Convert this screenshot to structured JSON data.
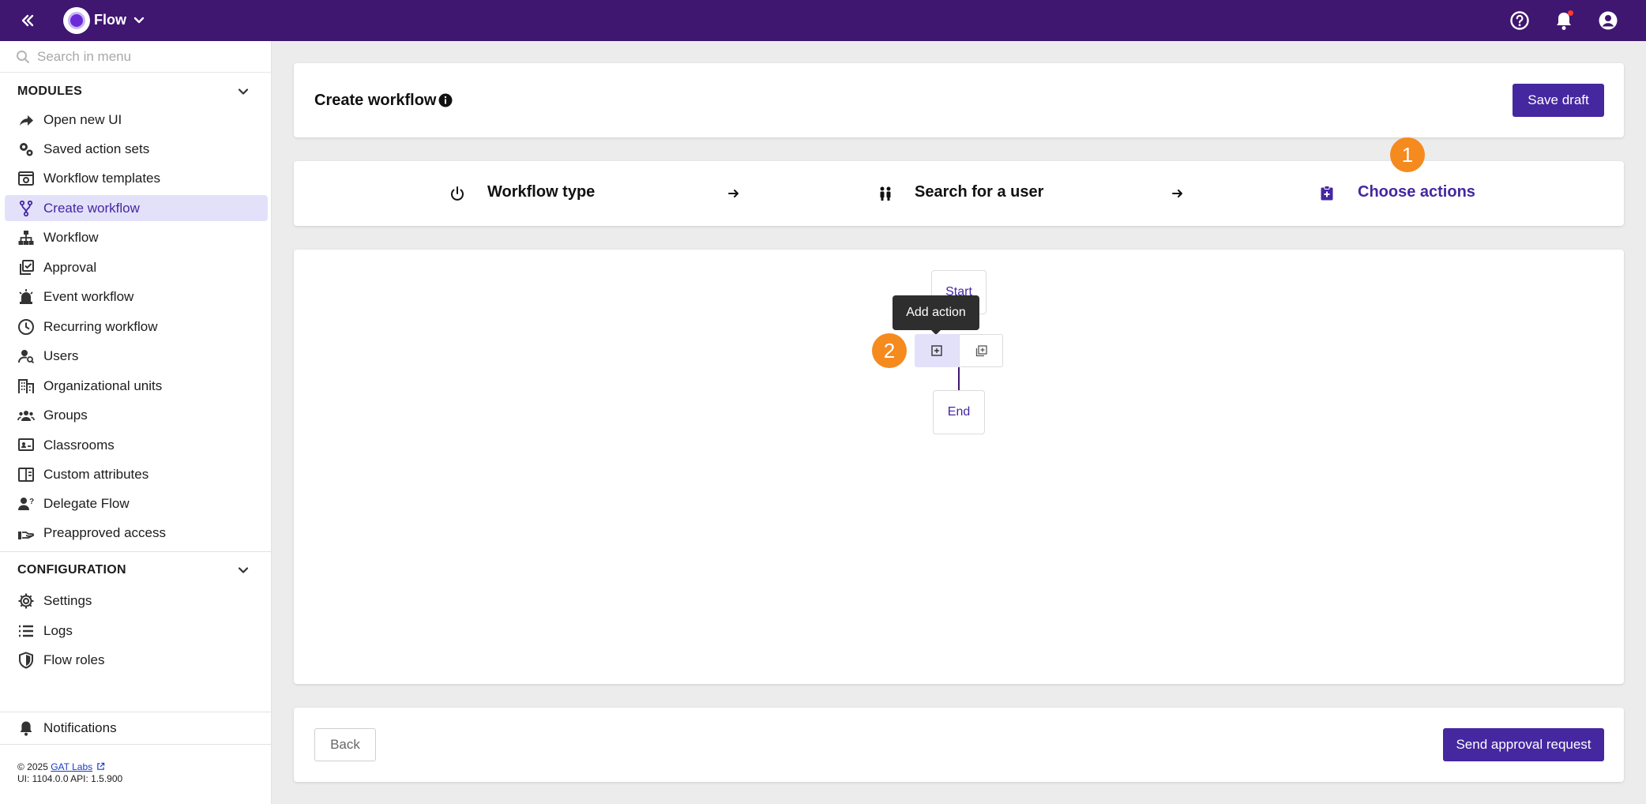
{
  "topbar": {
    "app_name": "Flow",
    "icons": [
      "collapse-sidebar-icon",
      "flow-logo-icon",
      "chevron-down-icon",
      "help-icon",
      "bell-icon",
      "account-icon"
    ],
    "notification_dot_color": "#ff3b30",
    "background": "#3f1670"
  },
  "sidebar": {
    "search_placeholder": "Search in menu",
    "modules_label": "MODULES",
    "modules": [
      {
        "label": "Open new UI",
        "icon": "share-arrow-icon"
      },
      {
        "label": "Saved action sets",
        "icon": "gears-icon"
      },
      {
        "label": "Workflow templates",
        "icon": "template-icon"
      },
      {
        "label": "Create workflow",
        "icon": "fork-icon",
        "active": true
      },
      {
        "label": "Workflow",
        "icon": "sitemap-icon"
      },
      {
        "label": "Approval",
        "icon": "approval-icon"
      },
      {
        "label": "Event workflow",
        "icon": "alarm-icon"
      },
      {
        "label": "Recurring workflow",
        "icon": "clock-icon"
      },
      {
        "label": "Users",
        "icon": "user-search-icon"
      },
      {
        "label": "Organizational units",
        "icon": "building-icon"
      },
      {
        "label": "Groups",
        "icon": "groups-icon"
      },
      {
        "label": "Classrooms",
        "icon": "classroom-icon"
      },
      {
        "label": "Custom attributes",
        "icon": "attributes-icon"
      },
      {
        "label": "Delegate Flow",
        "icon": "delegate-user-icon"
      },
      {
        "label": "Preapproved access",
        "icon": "preapproved-hand-icon"
      }
    ],
    "configuration_label": "CONFIGURATION",
    "configuration": [
      {
        "label": "Settings",
        "icon": "gear-icon"
      },
      {
        "label": "Logs",
        "icon": "list-icon"
      },
      {
        "label": "Flow roles",
        "icon": "shield-icon"
      }
    ],
    "notifications_label": "Notifications",
    "footer": {
      "copyright": "© 2025",
      "company_link": "GAT Labs",
      "versions": "UI: 1104.0.0 API: 1.5.900"
    },
    "active_color": "#4527a0",
    "active_background": "#e3e1fa"
  },
  "header": {
    "title": "Create workflow",
    "save_draft_label": "Save draft"
  },
  "steps": [
    {
      "label": "Workflow type",
      "icon": "power-icon"
    },
    {
      "label": "Search for a user",
      "icon": "users-icon"
    },
    {
      "label": "Choose actions",
      "icon": "clipboard-add-icon",
      "current": true
    }
  ],
  "badges": {
    "one": "1",
    "two": "2",
    "color": "#f58a1f"
  },
  "canvas": {
    "start_label": "Start",
    "end_label": "End",
    "tooltip": "Add action"
  },
  "footer": {
    "back_label": "Back",
    "send_label": "Send approval request"
  }
}
